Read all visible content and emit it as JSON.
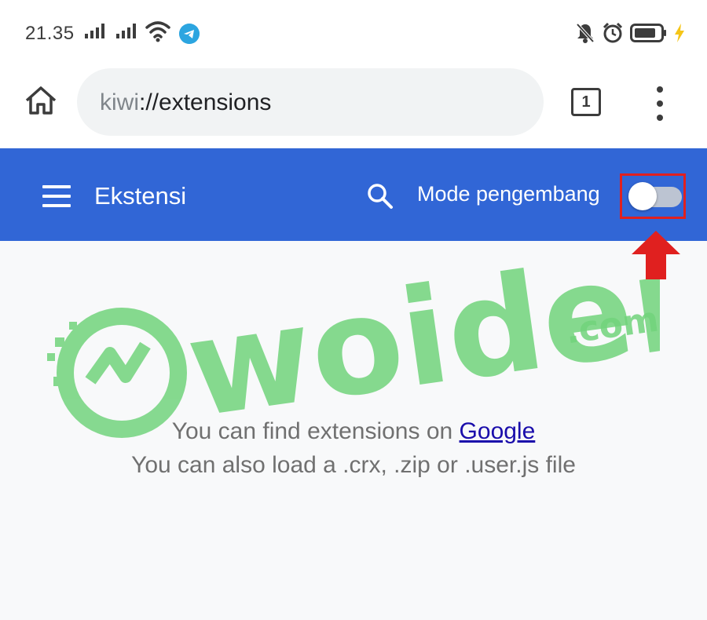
{
  "status_bar": {
    "time": "21.35",
    "icons": [
      "signal-icon",
      "signal-icon",
      "wifi-icon",
      "telegram-icon",
      "muted-notification-icon",
      "alarm-icon",
      "battery-icon",
      "charging-icon"
    ]
  },
  "address_bar": {
    "url_scheme": "kiwi",
    "url_rest": "://extensions",
    "tab_count": "1"
  },
  "toolbar": {
    "title": "Ekstensi",
    "developer_mode_label": "Mode pengembang",
    "developer_mode_on": false,
    "accent": "#3166d6"
  },
  "main": {
    "line1_prefix": "You can find extensions on",
    "line1_link": "Google",
    "line2": "You can also load a .crx, .zip or .user.js file"
  },
  "watermark": {
    "brand": "woiden",
    "suffix": ".com",
    "color": "#72d47c"
  },
  "annotation": {
    "highlight_color": "#e0201f"
  }
}
